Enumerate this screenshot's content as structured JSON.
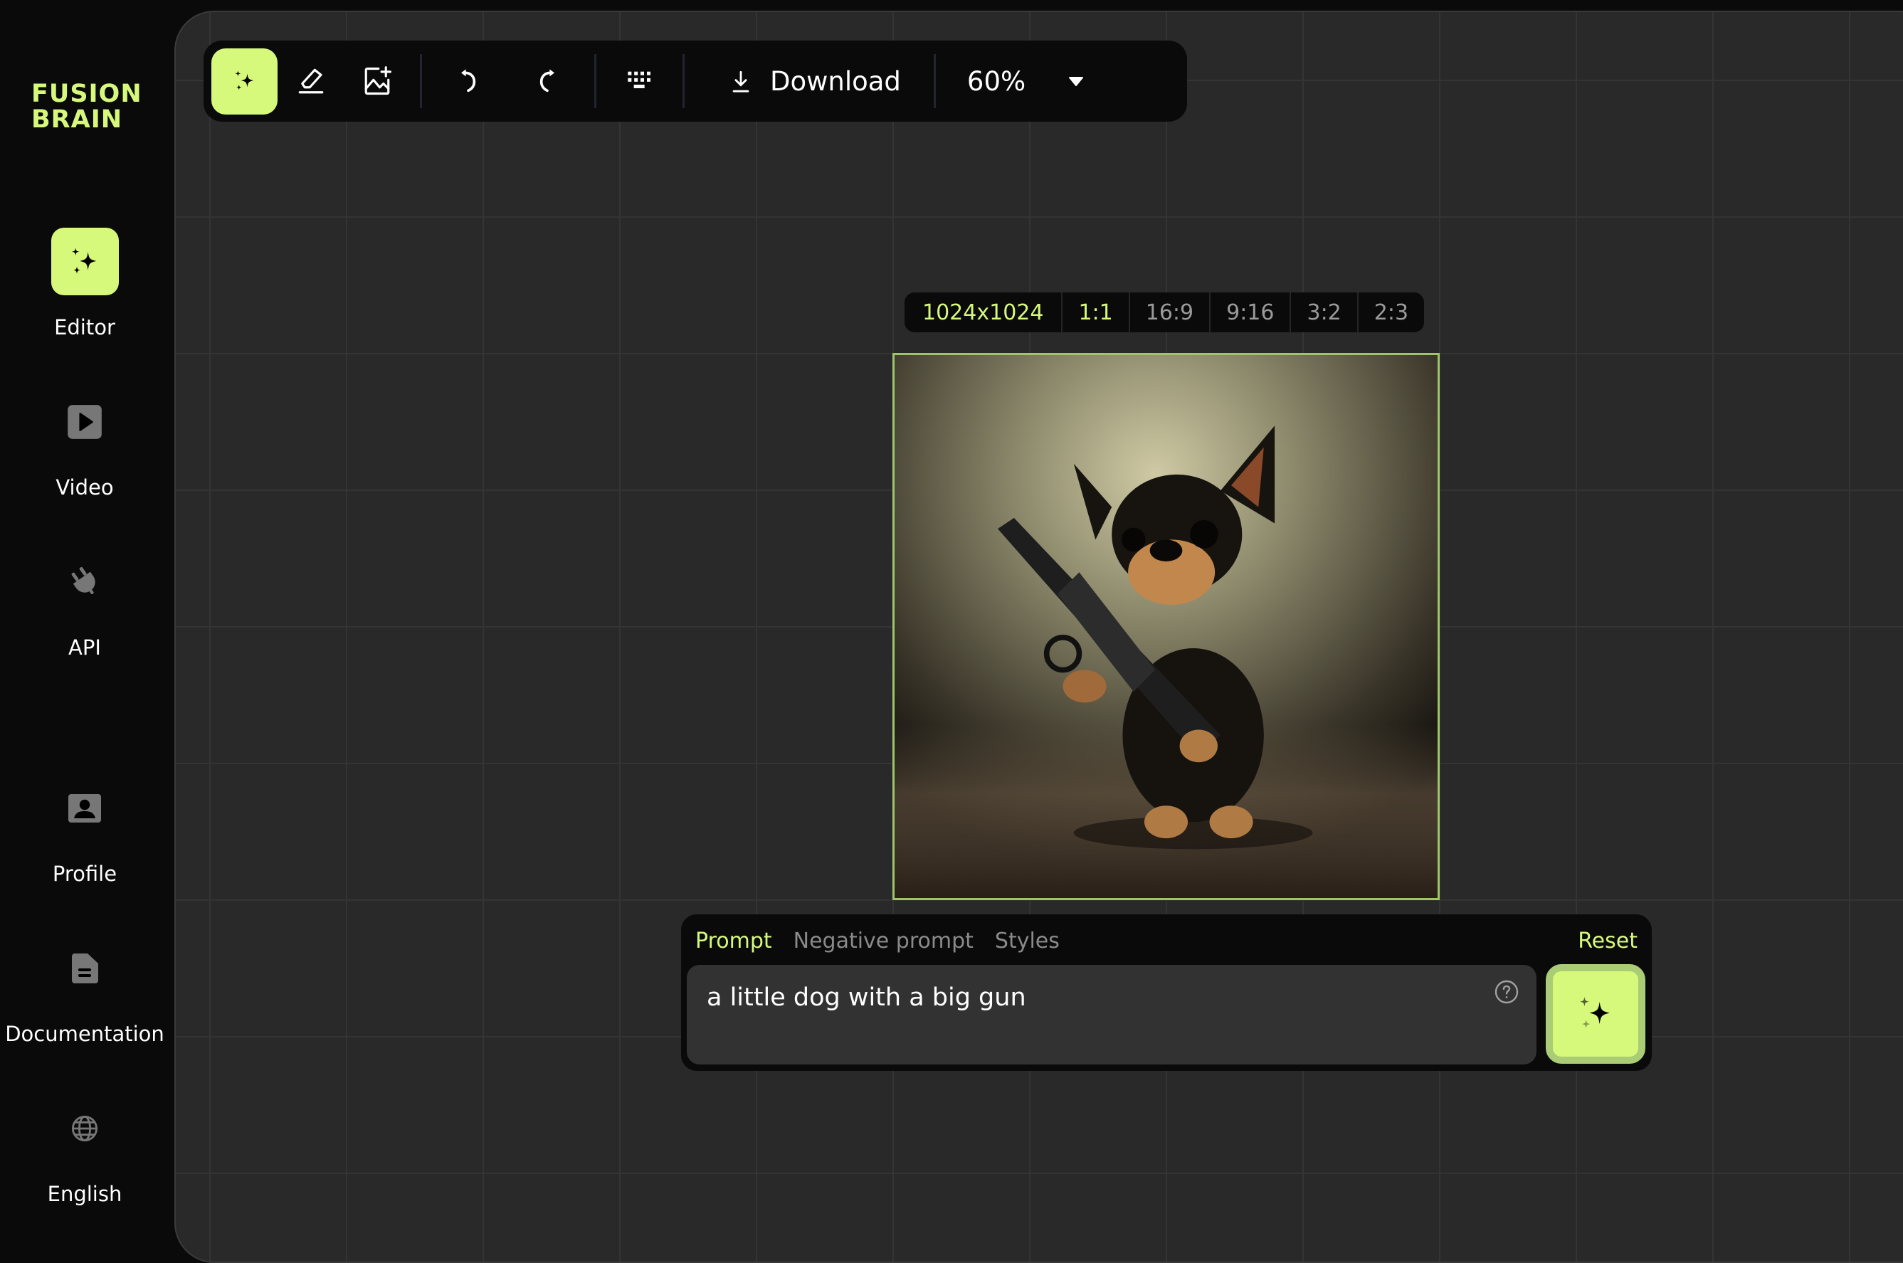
{
  "brand": {
    "line1": "FUSION",
    "line2": "BRAIN",
    "accent_color": "#d6f97b"
  },
  "sidebar": {
    "items": [
      {
        "label": "Editor",
        "icon": "sparkles-icon",
        "active": true
      },
      {
        "label": "Video",
        "icon": "play-icon",
        "active": false
      },
      {
        "label": "API",
        "icon": "plug-icon",
        "active": false
      },
      {
        "label": "Profile",
        "icon": "profile-icon",
        "active": false
      },
      {
        "label": "Documentation",
        "icon": "document-icon",
        "active": false
      },
      {
        "label": "English",
        "icon": "globe-icon",
        "active": false
      }
    ]
  },
  "toolbar": {
    "tools": [
      {
        "name": "generate",
        "icon": "sparkles-icon",
        "active": true
      },
      {
        "name": "eraser",
        "icon": "eraser-icon",
        "active": false
      },
      {
        "name": "add-image",
        "icon": "image-add-icon",
        "active": false
      },
      {
        "name": "undo",
        "icon": "undo-icon",
        "active": false
      },
      {
        "name": "redo",
        "icon": "redo-icon",
        "active": false
      },
      {
        "name": "shortcuts",
        "icon": "keyboard-icon",
        "active": false
      }
    ],
    "download_label": "Download",
    "zoom_value": "60%"
  },
  "ratio_bar": {
    "resolution": "1024x1024",
    "options": [
      "1:1",
      "16:9",
      "9:16",
      "3:2",
      "2:3"
    ],
    "selected": "1:1"
  },
  "image": {
    "description": "Generated image: small black-and-tan dog holding a large gun"
  },
  "prompt_panel": {
    "tabs": [
      {
        "label": "Prompt",
        "active": true
      },
      {
        "label": "Negative prompt",
        "active": false
      },
      {
        "label": "Styles",
        "active": false
      }
    ],
    "reset_label": "Reset",
    "prompt_value": "a little dog with a big gun"
  }
}
